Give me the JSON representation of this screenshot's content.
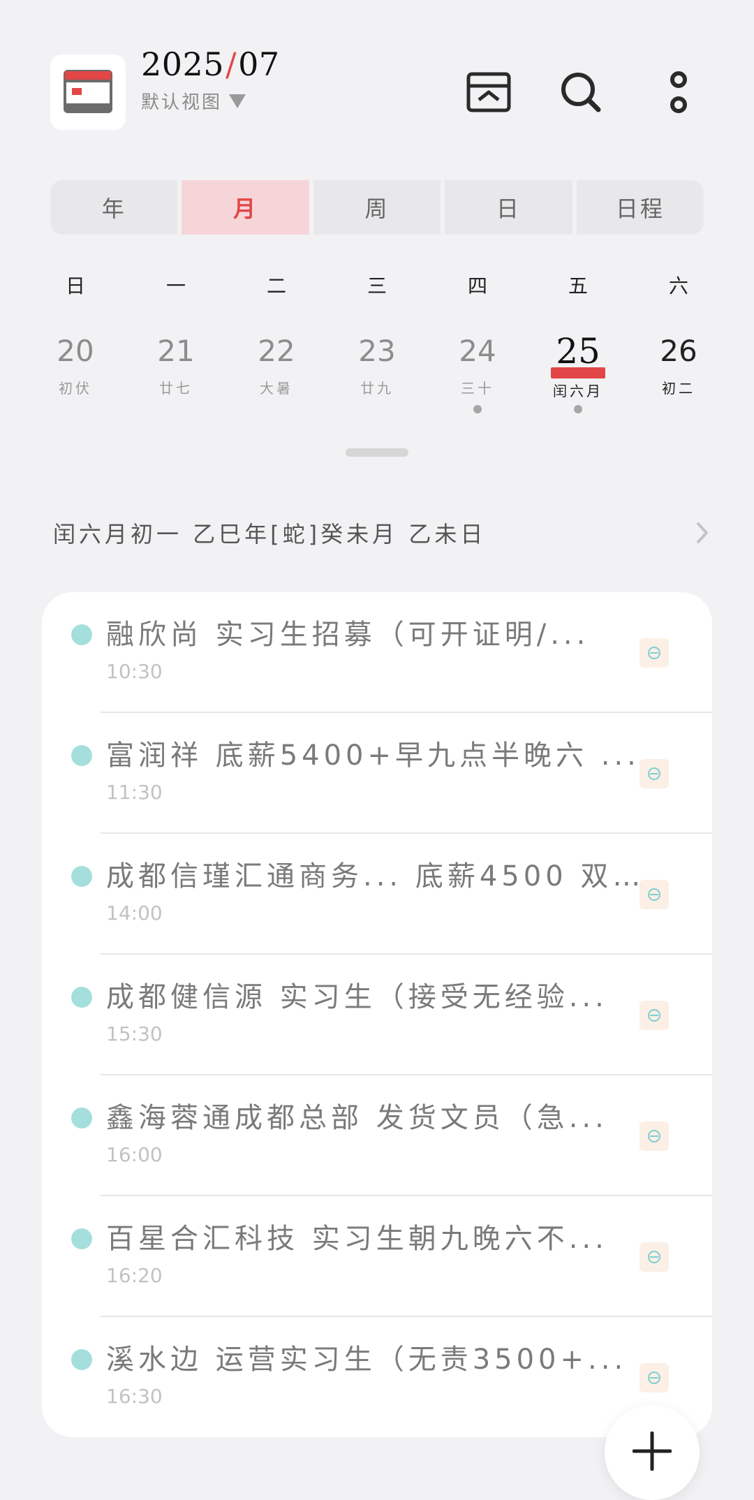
{
  "header": {
    "year": "2025",
    "slash": "/",
    "month": "07",
    "view_label": "默认视图",
    "icons": {
      "app": "calendar-app-icon",
      "archive": "archive-icon",
      "search": "search-icon",
      "more": "more-vertical-icon"
    },
    "accent_color": "#e24646"
  },
  "tabs": [
    {
      "label": "年",
      "active": false
    },
    {
      "label": "月",
      "active": true
    },
    {
      "label": "周",
      "active": false
    },
    {
      "label": "日",
      "active": false
    },
    {
      "label": "日程",
      "active": false
    }
  ],
  "week": {
    "weekdays": [
      "日",
      "一",
      "二",
      "三",
      "四",
      "五",
      "六"
    ],
    "days": [
      {
        "num": "20",
        "lunar": "初伏"
      },
      {
        "num": "21",
        "lunar": "廿七"
      },
      {
        "num": "22",
        "lunar": "大暑"
      },
      {
        "num": "23",
        "lunar": "廿九"
      },
      {
        "num": "24",
        "lunar": "三十",
        "has_event": true
      },
      {
        "num": "25",
        "lunar": "闰六月",
        "today": true,
        "has_event": true
      },
      {
        "num": "26",
        "lunar": "初二"
      }
    ]
  },
  "lunar_info": "闰六月初一  乙巳年[蛇]癸未月 乙未日",
  "events": [
    {
      "title": "融欣尚 实习生招募（可开证明/...",
      "time": "10:30"
    },
    {
      "title": "富润祥 底薪5400+早九点半晚六 ...",
      "time": "11:30"
    },
    {
      "title": "成都信瑾汇通商务... 底薪4500 双...",
      "time": "14:00"
    },
    {
      "title": "成都健信源 实习生（接受无经验...",
      "time": "15:30"
    },
    {
      "title": "鑫海蓉通成都总部 发货文员（急...",
      "time": "16:00"
    },
    {
      "title": "百星合汇科技 实习生朝九晚六不...",
      "time": "16:20"
    },
    {
      "title": "溪水边 运营实习生（无责3500+...",
      "time": "16:30"
    }
  ],
  "event_color": "#a5dfdd",
  "fab_icon": "plus-icon"
}
